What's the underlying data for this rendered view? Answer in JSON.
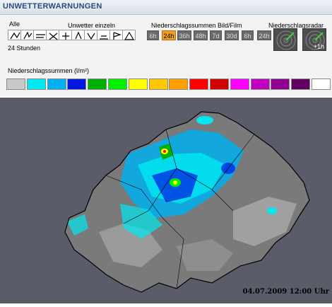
{
  "title": "UNWETTERWARNUNGEN",
  "labels": {
    "alle": "Alle",
    "unwetter_einzeln": "Unwetter einzeln",
    "niederschlagssummen_bild": "Niederschlagssummen Bild/Film",
    "niederschlagsradar": "Niederschlagsradar",
    "stunden": "24 Stunden",
    "niederschlagssummen_legend": "Niederschlagssummen (l/m²)"
  },
  "warning_icons": [
    "all-warnings-icon",
    "thunderstorm-icon",
    "hail-icon",
    "wind-icon",
    "snow-icon",
    "frost-icon",
    "rain-icon",
    "flood-icon",
    "storm-flag-icon",
    "avalanche-icon"
  ],
  "sum_chips": [
    {
      "label": "6h",
      "active": false
    },
    {
      "label": "24h",
      "active": true
    },
    {
      "label": "36h",
      "active": false
    },
    {
      "label": "48h",
      "active": false
    },
    {
      "label": "7d",
      "active": false
    },
    {
      "label": "30d",
      "active": false
    },
    {
      "label": "6h",
      "active": false
    },
    {
      "label": "24h",
      "active": false
    }
  ],
  "radar": {
    "current_icon": "radar-current-icon",
    "forecast_label": "+1h"
  },
  "legend_colors": [
    "#c8c8c8",
    "#00e8f0",
    "#00b0f0",
    "#0018e0",
    "#00b000",
    "#00f000",
    "#ffff00",
    "#ffc800",
    "#ffa000",
    "#ff0000",
    "#d00000",
    "#ff00ff",
    "#c000c0",
    "#900090",
    "#600060",
    "#ffffff"
  ],
  "timestamp": "04.07.2009 12:00 Uhr"
}
